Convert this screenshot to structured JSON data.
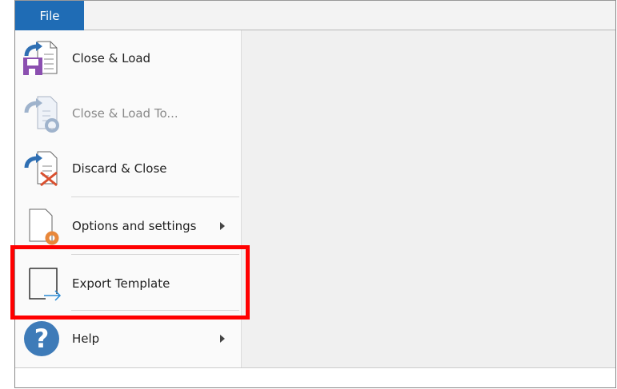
{
  "tab": {
    "label": "File",
    "color": "#1f6cb5"
  },
  "menu": {
    "items": [
      {
        "label": "Close & Load",
        "icon": "close-and-load-icon",
        "enabled": true
      },
      {
        "label": "Close & Load To...",
        "icon": "close-and-load-to-icon",
        "enabled": false
      },
      {
        "label": "Discard & Close",
        "icon": "discard-and-close-icon",
        "enabled": true
      },
      {
        "label": "Options and settings",
        "icon": "options-settings-icon",
        "enabled": true,
        "submenu": true
      },
      {
        "label": "Export Template",
        "icon": "export-template-icon",
        "enabled": true,
        "highlighted": true
      },
      {
        "label": "Help",
        "icon": "help-icon",
        "enabled": true,
        "submenu": true
      }
    ]
  },
  "highlight_color": "#ff0000"
}
